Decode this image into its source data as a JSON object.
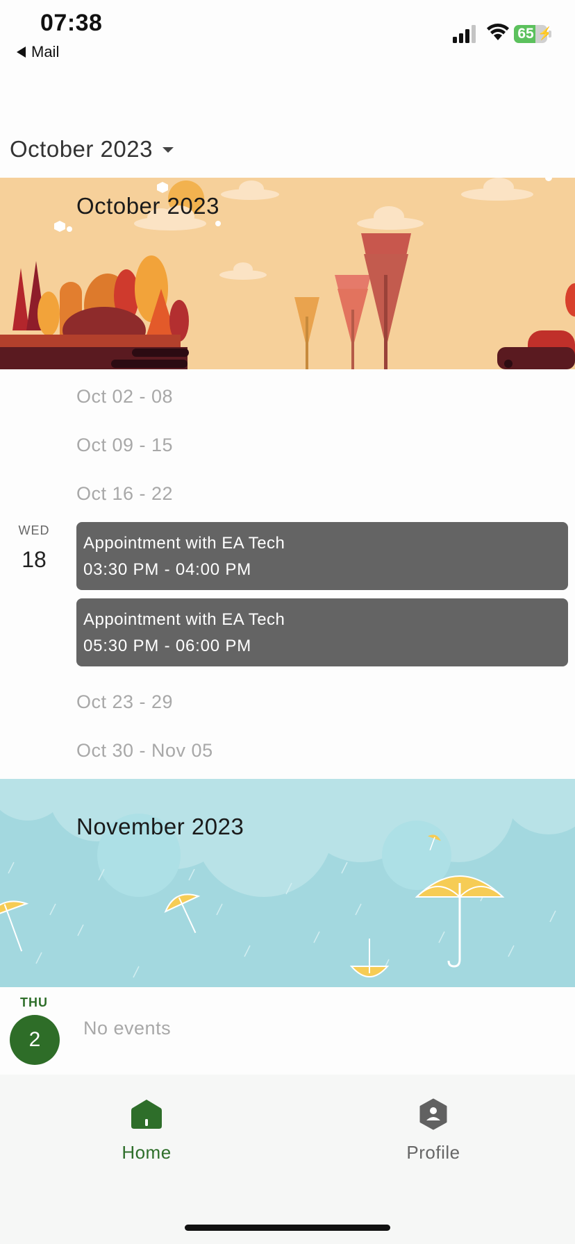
{
  "status_bar": {
    "time": "07:38",
    "back_label": "Mail",
    "battery_percent": "65",
    "battery_level": 0.65,
    "battery_color": "#5cc15d"
  },
  "header": {
    "month_selector_label": "October 2023"
  },
  "months": [
    {
      "title": "October 2023",
      "banner_theme": "autumn-trees",
      "weeks_before": [
        "Oct 02 - 08",
        "Oct 09 - 15",
        "Oct 16 - 22"
      ],
      "day": {
        "weekday": "WED",
        "date": "18",
        "events": [
          {
            "title": "Appointment with EA Tech",
            "time": "03:30 PM - 04:00 PM"
          },
          {
            "title": "Appointment with EA Tech",
            "time": "05:30 PM - 06:00 PM"
          }
        ]
      },
      "weeks_after": [
        "Oct 23 - 29",
        "Oct 30 - Nov 05"
      ]
    },
    {
      "title": "November 2023",
      "banner_theme": "rain-umbrellas",
      "day": {
        "weekday": "THU",
        "date": "2",
        "empty_text": "No events"
      }
    }
  ],
  "bottom_nav": {
    "items": [
      {
        "label": "Home",
        "icon": "home-icon",
        "active": true
      },
      {
        "label": "Profile",
        "icon": "profile-icon",
        "active": false
      }
    ]
  },
  "colors": {
    "accent_green": "#2e6e2a",
    "event_gray": "#646464",
    "october_banner": "#f6d09a",
    "november_banner": "#a3d8df"
  }
}
